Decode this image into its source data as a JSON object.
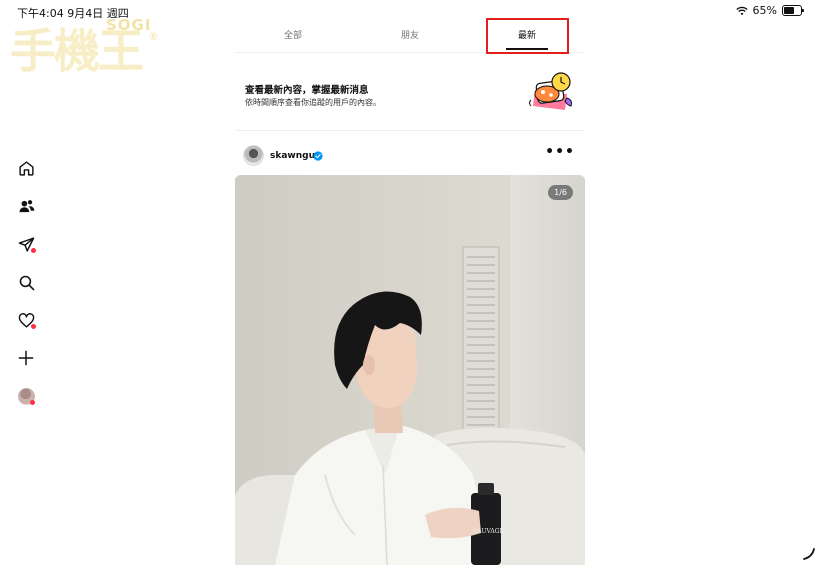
{
  "status_bar": {
    "time_date": "下午4:04 9月4日 週四",
    "battery": "65%"
  },
  "watermark": {
    "brand": "SOGI",
    "name": "手機王",
    "reg": "®"
  },
  "tabs": [
    {
      "label": "全部"
    },
    {
      "label": "朋友"
    },
    {
      "label": "最新"
    }
  ],
  "banner": {
    "title": "查看最新內容，掌握最新消息",
    "subtitle": "依時間順序查看你追蹤的用戶的內容。"
  },
  "post": {
    "username": "skawngur",
    "photo_counter": "1/6",
    "bottle_text": "SAUVAGE"
  },
  "colors": {
    "highlight": "#e21f1f",
    "verified": "#0095f6",
    "notification_dot": "#ff3040"
  },
  "icons": {
    "sidebar": [
      "home-icon",
      "friends-icon",
      "messages-icon",
      "search-icon",
      "heart-icon",
      "create-icon",
      "profile-avatar"
    ],
    "post": [
      "verified-badge-icon",
      "more-options-icon"
    ]
  }
}
